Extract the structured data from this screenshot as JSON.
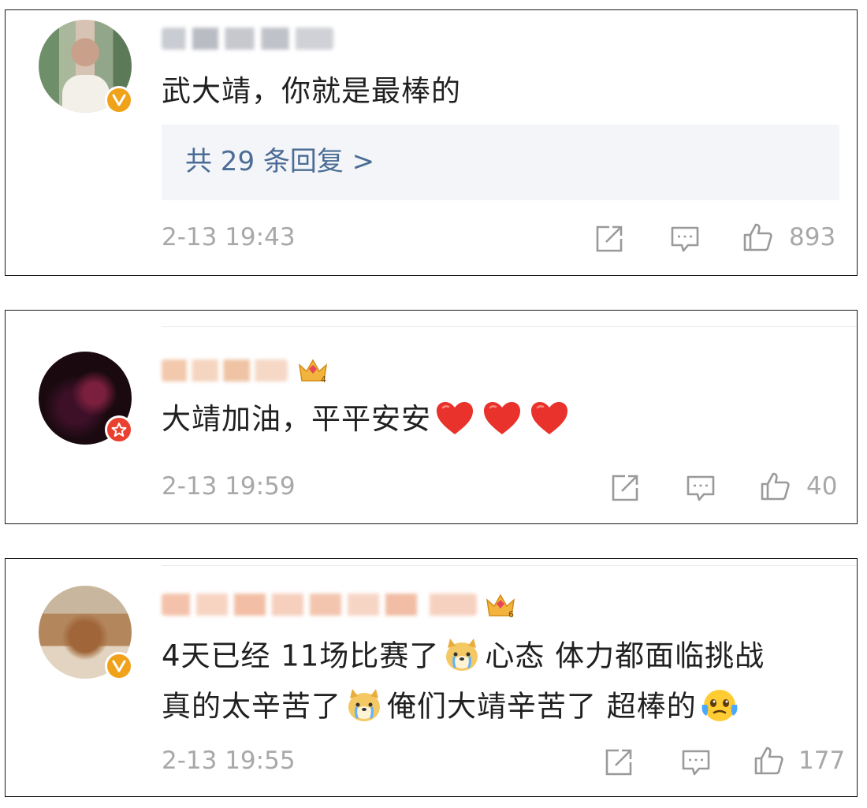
{
  "comments": [
    {
      "badge_type": "verified-v",
      "text": "武大靖，你就是最棒的",
      "reply_link": "共 29 条回复 >",
      "time": "2-13 19:43",
      "likes": "893"
    },
    {
      "badge_type": "star",
      "crown_level": "4",
      "text": "大靖加油，平平安安",
      "emojis": [
        "heart",
        "heart",
        "heart"
      ],
      "time": "2-13 19:59",
      "likes": "40"
    },
    {
      "badge_type": "verified-v",
      "crown_level": "6",
      "text_line1_a": "4天已经 11场比赛了",
      "text_line1_b": "心态 体力都面临挑战",
      "text_line2_a": "真的太辛苦了",
      "text_line2_b": "俺们大靖辛苦了  超棒的",
      "emojis": [
        "crying-doge",
        "crying-doge",
        "tearful-face"
      ],
      "time": "2-13 19:55",
      "likes": "177"
    }
  ],
  "colors": {
    "reply_link": "#4a6c95",
    "meta_gray": "#a8a8a8",
    "verified_badge": "#f0a21a",
    "star_badge": "#e9402f",
    "heart": "#e8322b"
  },
  "icons": [
    "share-icon",
    "comment-icon",
    "like-icon",
    "crown-icon",
    "verified-badge-icon",
    "star-badge-icon"
  ]
}
